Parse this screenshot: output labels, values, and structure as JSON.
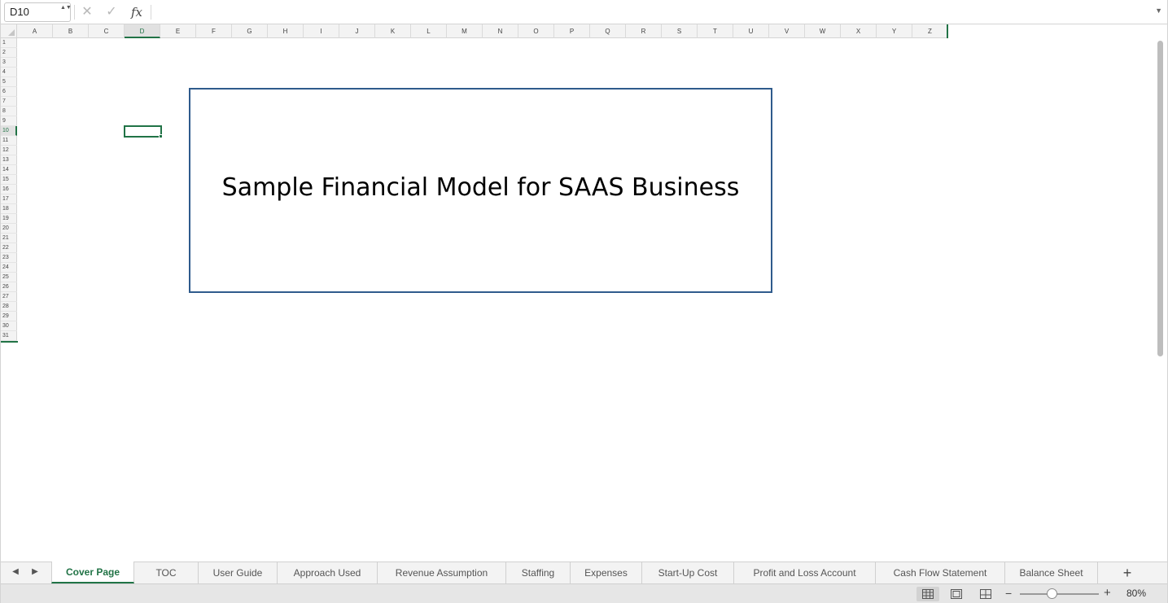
{
  "formula_bar": {
    "name_box": "D10",
    "stepper": "▲▼",
    "cancel_icon": "✕",
    "enter_icon": "✓",
    "fx_label": "fx",
    "formula_value": "",
    "expand_icon": "▼"
  },
  "grid": {
    "columns": [
      "A",
      "B",
      "C",
      "D",
      "E",
      "F",
      "G",
      "H",
      "I",
      "J",
      "K",
      "L",
      "M",
      "N",
      "O",
      "P",
      "Q",
      "R",
      "S",
      "T",
      "U",
      "V",
      "W",
      "X",
      "Y",
      "Z"
    ],
    "active_column": "D",
    "rows": [
      "1",
      "2",
      "3",
      "4",
      "5",
      "6",
      "7",
      "8",
      "9",
      "10",
      "11",
      "12",
      "13",
      "14",
      "15",
      "16",
      "17",
      "18",
      "19",
      "20",
      "21",
      "22",
      "23",
      "24",
      "25",
      "26",
      "27",
      "28",
      "29",
      "30",
      "31"
    ],
    "active_row": "10"
  },
  "content": {
    "title": "Sample Financial Model for SAAS Business"
  },
  "tabs": {
    "prev_icon": "◀",
    "next_icon": "▶",
    "active": "Cover Page",
    "items": [
      "Cover Page",
      "TOC",
      "User Guide",
      "Approach Used",
      "Revenue Assumption",
      "Staffing",
      "Expenses",
      "Start-Up Cost",
      "Profit and Loss Account",
      "Cash Flow Statement",
      "Balance Sheet"
    ],
    "add_icon": "+"
  },
  "status": {
    "zoom_out": "−",
    "zoom_in": "+",
    "zoom_level": "80%",
    "zoom_percent": 80
  },
  "colors": {
    "accent": "#217346",
    "title_border": "#2f5b8c"
  }
}
